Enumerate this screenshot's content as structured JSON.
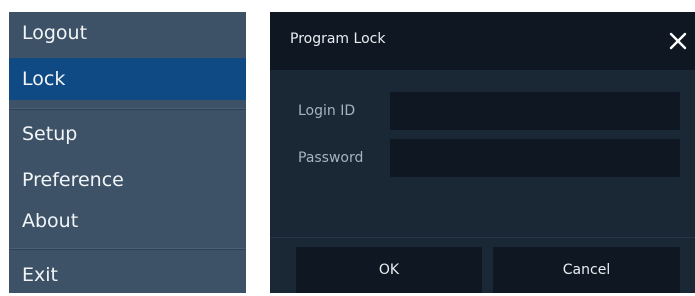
{
  "menu": {
    "items": [
      {
        "label": "Logout"
      },
      {
        "label": "Lock",
        "selected": true
      },
      {
        "label": "Setup"
      },
      {
        "label": "Preference"
      },
      {
        "label": "About"
      },
      {
        "label": "Exit"
      }
    ]
  },
  "dialog": {
    "title": "Program Lock",
    "close_icon": "close-x",
    "fields": {
      "login_id": {
        "label": "Login ID",
        "value": ""
      },
      "password": {
        "label": "Password",
        "value": ""
      }
    },
    "ok_label": "OK",
    "cancel_label": "Cancel"
  },
  "colors": {
    "menu_bg": "#3d5266",
    "menu_selected": "#104a84",
    "dialog_bg": "#1a2735",
    "dialog_header": "#0f1822"
  }
}
